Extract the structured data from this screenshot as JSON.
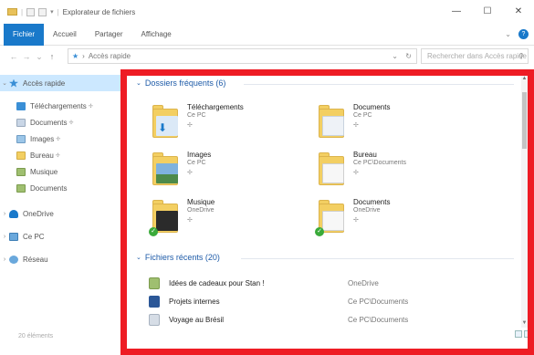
{
  "window": {
    "title": "Explorateur de fichiers",
    "controls": {
      "minimize": "—",
      "maximize": "☐",
      "close": "✕"
    }
  },
  "ribbon": {
    "tabs": [
      "Fichier",
      "Accueil",
      "Partager",
      "Affichage"
    ],
    "expand_glyph": "⌄",
    "help_glyph": "?"
  },
  "navigation": {
    "back": "←",
    "forward": "→",
    "recent_dropdown": "⌄",
    "up": "↑",
    "address_separator": "›",
    "address": "Accès rapide",
    "address_dropdown": "⌄",
    "refresh": "↻",
    "search_placeholder": "Rechercher dans Accès rapide",
    "search_icon": "⚲"
  },
  "sidebar": {
    "items": [
      {
        "label": "Accès rapide",
        "icon": "star-icon",
        "color": "#3a8fd6",
        "active": true,
        "expander": "⌄"
      },
      {
        "label": "Téléchargements",
        "icon": "downloads-icon",
        "color": "#3a8fd6",
        "pinned": true
      },
      {
        "label": "Documents",
        "icon": "documents-icon",
        "color": "#c9d6e6",
        "pinned": true
      },
      {
        "label": "Images",
        "icon": "images-icon",
        "color": "#9cc6e8",
        "pinned": true
      },
      {
        "label": "Bureau",
        "icon": "desktop-icon",
        "color": "#f3cf62",
        "pinned": true
      },
      {
        "label": "Musique",
        "icon": "music-icon",
        "color": "#9fbf70"
      },
      {
        "label": "Documents",
        "icon": "documents-icon",
        "color": "#9fbf70"
      },
      {
        "label": "OneDrive",
        "icon": "onedrive-icon",
        "color": "#1979ca",
        "expander": "›"
      },
      {
        "label": "Ce PC",
        "icon": "pc-icon",
        "color": "#6aa8dc",
        "expander": "›"
      },
      {
        "label": "Réseau",
        "icon": "network-icon",
        "color": "#6aa8dc",
        "expander": "›"
      }
    ],
    "status": "20 éléments"
  },
  "frequent": {
    "heading": "Dossiers fréquents (6)",
    "expander": "⌄",
    "folders": [
      {
        "name": "Téléchargements",
        "location": "Ce PC",
        "pin": "✢",
        "icon": "downloads-folder-icon",
        "badge": "⬇",
        "front_color": "#dbe9f7"
      },
      {
        "name": "Documents",
        "location": "Ce PC",
        "pin": "✢",
        "icon": "documents-folder-icon",
        "badge": "",
        "front_color": "#eef2f7"
      },
      {
        "name": "Images",
        "location": "Ce PC",
        "pin": "✢",
        "icon": "images-folder-icon",
        "badge": "",
        "front_color": "#7fb2de"
      },
      {
        "name": "Bureau",
        "location": "Ce PC\\Documents",
        "pin": "✢",
        "icon": "desktop-folder-icon",
        "badge": "",
        "front_color": "#f7f7f7"
      },
      {
        "name": "Musique",
        "location": "OneDrive",
        "pin": "✢",
        "icon": "music-folder-icon",
        "badge": "",
        "front_color": "#2b2b2b",
        "synced": true
      },
      {
        "name": "Documents",
        "location": "OneDrive",
        "pin": "✢",
        "icon": "documents-folder-icon",
        "badge": "",
        "front_color": "#f7f7f7",
        "synced": true
      }
    ],
    "sync_glyph": "✓"
  },
  "recent": {
    "heading": "Fichiers récents (20)",
    "expander": "⌄",
    "files": [
      {
        "name": "Idées de cadeaux pour Stan !",
        "location": "OneDrive",
        "icon": "text-file-icon",
        "color": "#9fbf70"
      },
      {
        "name": "Projets internes",
        "location": "Ce PC\\Documents",
        "icon": "word-file-icon",
        "color": "#2b5797"
      },
      {
        "name": "Voyage au Brésil",
        "location": "Ce PC\\Documents",
        "icon": "document-file-icon",
        "color": "#d6dde6"
      }
    ]
  },
  "scrollbar": {
    "up": "▲",
    "down": "▼"
  },
  "accent_colors": {
    "file_tab": "#1979ca",
    "highlight_frame": "#ee1c24",
    "group_heading": "#1e5ba8"
  }
}
